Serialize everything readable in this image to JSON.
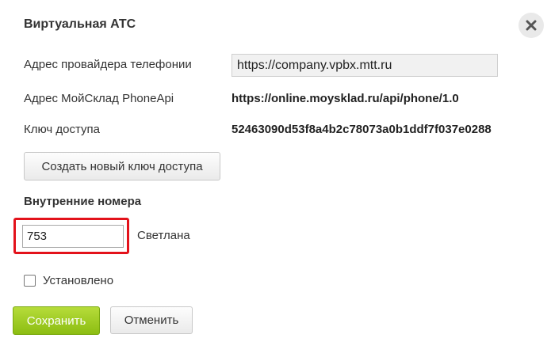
{
  "dialog": {
    "title": "Виртуальная АТС",
    "close_icon": "close-icon"
  },
  "fields": {
    "provider_address_label": "Адрес провайдера телефонии",
    "provider_address_value": "https://company.vpbx.mtt.ru",
    "phoneapi_address_label": "Адрес МойСклад PhoneApi",
    "phoneapi_address_value": "https://online.moysklad.ru/api/phone/1.0",
    "access_key_label": "Ключ доступа",
    "access_key_value": "52463090d53f8a4b2c78073a0b1ddf7f037e0288"
  },
  "buttons": {
    "new_key_label": "Создать новый ключ доступа",
    "save_label": "Сохранить",
    "cancel_label": "Отменить"
  },
  "internal_numbers": {
    "section_title": "Внутренние номера",
    "items": [
      {
        "number": "753",
        "name": "Светлана"
      }
    ]
  },
  "installed": {
    "label": "Установлено",
    "checked": false
  },
  "colors": {
    "save_button": "#9bc91f",
    "highlight_border": "#e3121b"
  }
}
